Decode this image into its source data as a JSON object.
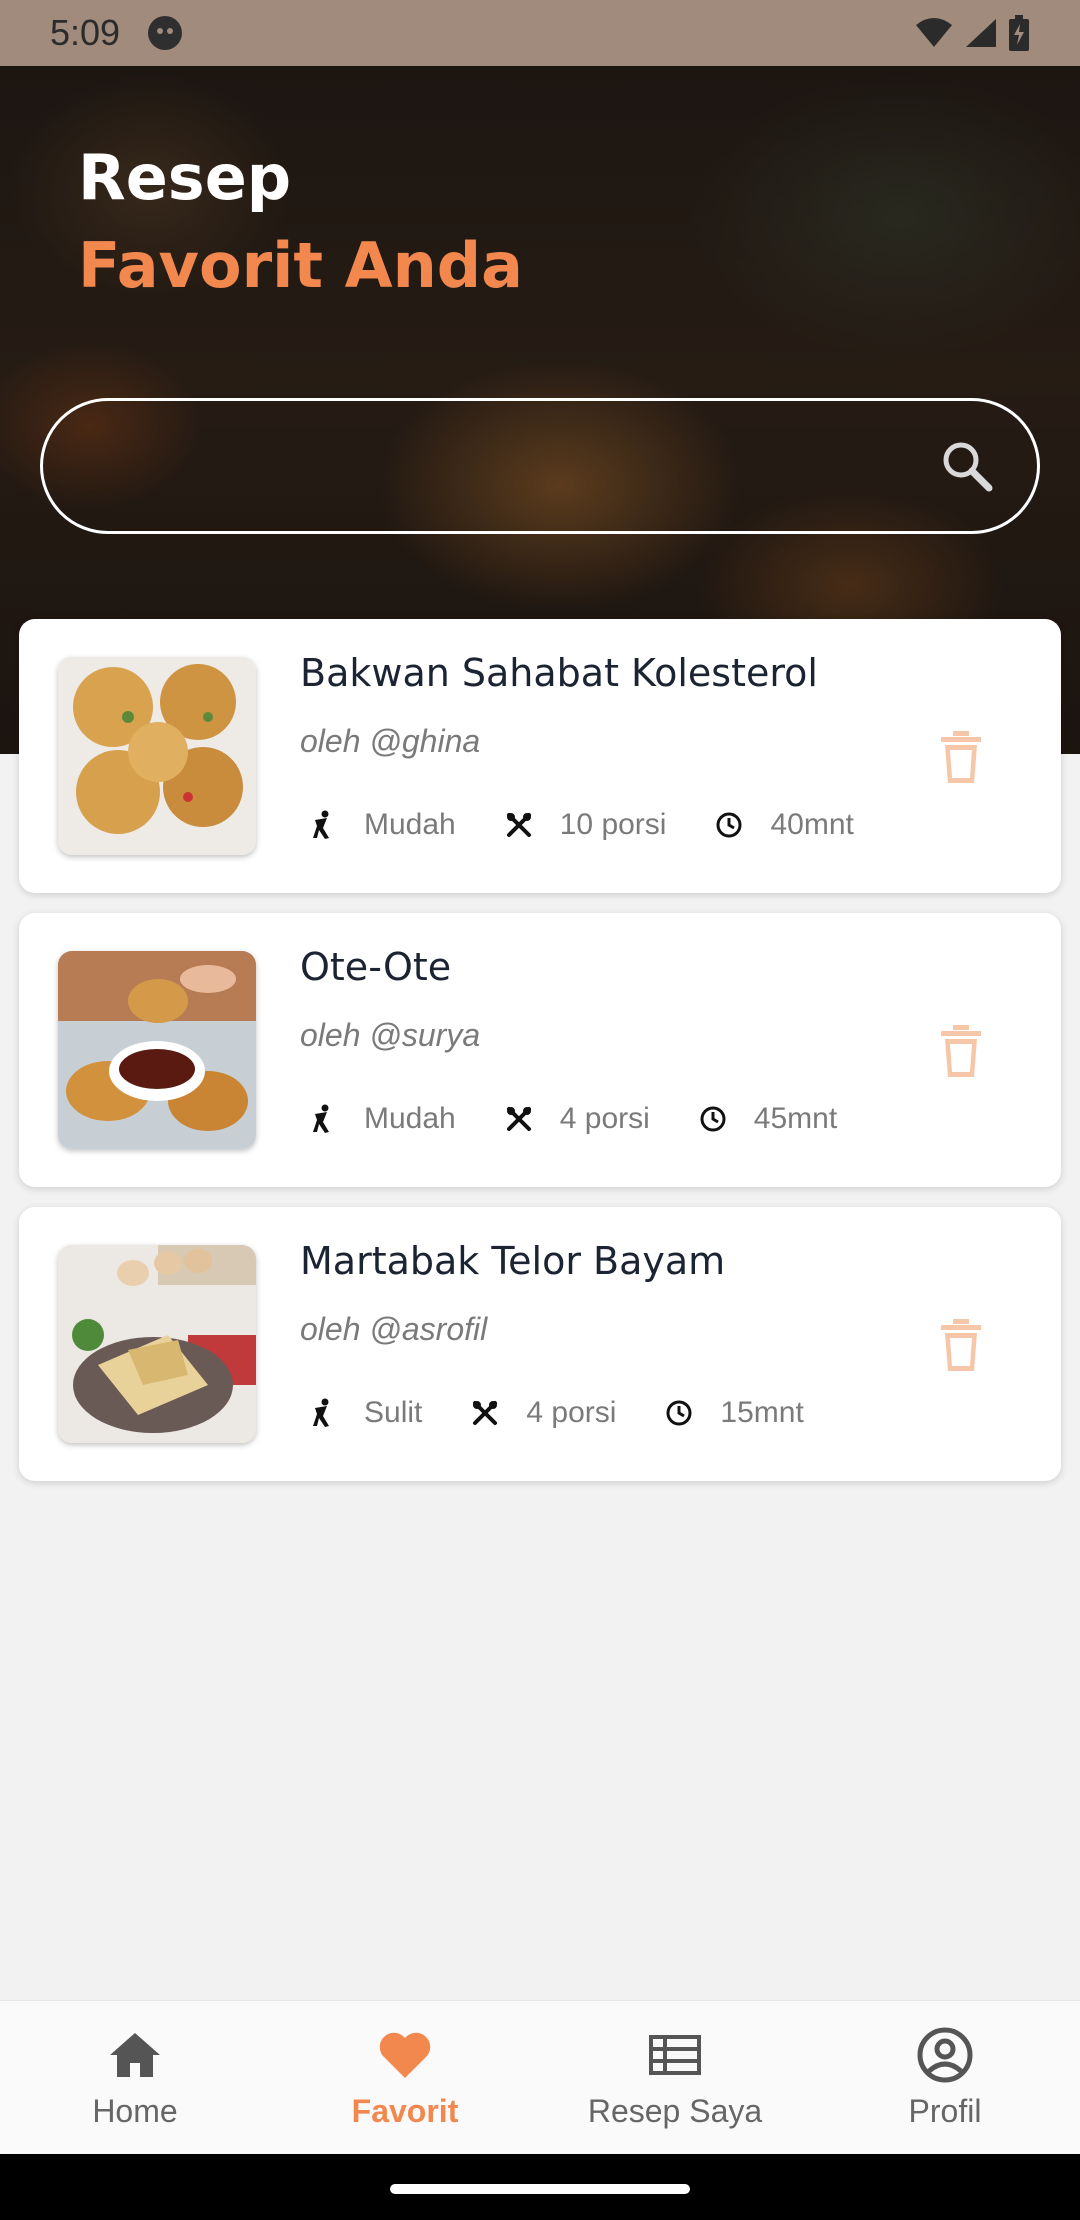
{
  "status_bar": {
    "time": "5:09"
  },
  "header": {
    "title_line1": "Resep",
    "title_line2": "Favorit Anda"
  },
  "search": {
    "placeholder": ""
  },
  "recipes": [
    {
      "title": "Bakwan Sahabat Kolesterol",
      "author": "oleh @ghina",
      "difficulty": "Mudah",
      "servings": "10 porsi",
      "time": "40mnt"
    },
    {
      "title": "Ote-Ote",
      "author": "oleh @surya",
      "difficulty": "Mudah",
      "servings": "4 porsi",
      "time": "45mnt"
    },
    {
      "title": "Martabak Telor Bayam",
      "author": "oleh @asrofil",
      "difficulty": "Sulit",
      "servings": "4 porsi",
      "time": "15mnt"
    }
  ],
  "nav": {
    "items": [
      {
        "label": "Home",
        "icon": "home-icon"
      },
      {
        "label": "Favorit",
        "icon": "heart-icon"
      },
      {
        "label": "Resep Saya",
        "icon": "list-icon"
      },
      {
        "label": "Profil",
        "icon": "profile-icon"
      }
    ]
  },
  "colors": {
    "accent": "#f2884e",
    "trash": "#f6c6a8",
    "title": "#1c2433"
  }
}
